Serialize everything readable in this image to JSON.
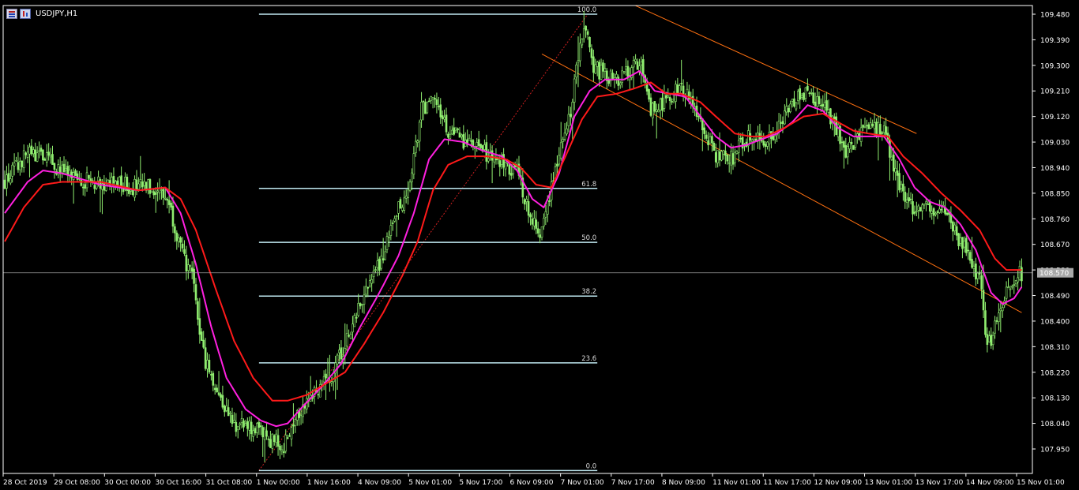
{
  "window": {
    "symbol_label": "USDJPY,H1"
  },
  "colors": {
    "background": "#000000",
    "axis": "#ffffff",
    "bull_candle": "#90ee70",
    "bear_candle": "#90ee70",
    "ma_fast": "#ff20e0",
    "ma_slow": "#ff1a1a",
    "fibo_level": "#c0e8f0",
    "fibo_trend": "#d02020",
    "channel": "#ff7010",
    "price_line": "#a0a0a0",
    "price_tag_bg": "#a8a8a8"
  },
  "chart_data": {
    "type": "candlestick",
    "symbol": "USDJPY",
    "timeframe": "H1",
    "y_ticks": [
      "109.480",
      "109.390",
      "109.300",
      "109.210",
      "109.120",
      "109.030",
      "108.940",
      "108.850",
      "108.760",
      "108.670",
      "108.580",
      "108.490",
      "108.400",
      "108.310",
      "108.220",
      "108.130",
      "108.040",
      "107.950"
    ],
    "ylim": [
      107.905,
      109.507
    ],
    "x_ticks": [
      "28 Oct 2019",
      "29 Oct 08:00",
      "30 Oct 00:00",
      "30 Oct 16:00",
      "31 Oct 08:00",
      "1 Nov 00:00",
      "1 Nov 16:00",
      "4 Nov 09:00",
      "5 Nov 01:00",
      "5 Nov 17:00",
      "6 Nov 09:00",
      "7 Nov 01:00",
      "7 Nov 17:00",
      "8 Nov 09:00",
      "11 Nov 01:00",
      "11 Nov 17:00",
      "12 Nov 09:00",
      "13 Nov 01:00",
      "13 Nov 17:00",
      "14 Nov 09:00",
      "15 Nov 01:00"
    ],
    "current_price": "108.570",
    "price_path": [
      [
        0,
        108.89
      ],
      [
        12,
        108.99
      ],
      [
        20,
        108.98
      ],
      [
        35,
        108.9
      ],
      [
        50,
        108.89
      ],
      [
        60,
        108.88
      ],
      [
        72,
        108.87
      ],
      [
        80,
        108.87
      ],
      [
        86,
        108.82
      ],
      [
        92,
        108.65
      ],
      [
        98,
        108.55
      ],
      [
        104,
        108.28
      ],
      [
        112,
        108.14
      ],
      [
        120,
        108.04
      ],
      [
        130,
        108.02
      ],
      [
        140,
        107.98
      ],
      [
        146,
        107.96
      ],
      [
        152,
        108.07
      ],
      [
        160,
        108.14
      ],
      [
        170,
        108.2
      ],
      [
        180,
        108.35
      ],
      [
        188,
        108.5
      ],
      [
        198,
        108.63
      ],
      [
        206,
        108.8
      ],
      [
        212,
        108.88
      ],
      [
        218,
        109.15
      ],
      [
        226,
        109.17
      ],
      [
        232,
        109.06
      ],
      [
        242,
        109.03
      ],
      [
        252,
        108.99
      ],
      [
        262,
        108.95
      ],
      [
        268,
        108.92
      ],
      [
        274,
        108.8
      ],
      [
        280,
        108.7
      ],
      [
        284,
        108.82
      ],
      [
        290,
        109.0
      ],
      [
        296,
        109.15
      ],
      [
        300,
        109.33
      ],
      [
        304,
        109.44
      ],
      [
        308,
        109.3
      ],
      [
        316,
        109.25
      ],
      [
        324,
        109.26
      ],
      [
        332,
        109.32
      ],
      [
        338,
        109.14
      ],
      [
        346,
        109.18
      ],
      [
        354,
        109.23
      ],
      [
        362,
        109.12
      ],
      [
        372,
        108.98
      ],
      [
        380,
        108.97
      ],
      [
        390,
        109.06
      ],
      [
        398,
        109.03
      ],
      [
        404,
        109.06
      ],
      [
        412,
        109.17
      ],
      [
        420,
        109.2
      ],
      [
        428,
        109.15
      ],
      [
        434,
        109.1
      ],
      [
        440,
        109.0
      ],
      [
        448,
        109.06
      ],
      [
        454,
        109.07
      ],
      [
        460,
        109.08
      ],
      [
        466,
        108.92
      ],
      [
        474,
        108.8
      ],
      [
        482,
        108.8
      ],
      [
        490,
        108.79
      ],
      [
        498,
        108.7
      ],
      [
        504,
        108.63
      ],
      [
        510,
        108.55
      ],
      [
        514,
        108.3
      ],
      [
        518,
        108.38
      ],
      [
        524,
        108.5
      ],
      [
        530,
        108.58
      ],
      [
        532,
        108.57
      ]
    ],
    "series": [
      {
        "name": "",
        "color": "#ff20e0",
        "values": [
          [
            0,
            108.78
          ],
          [
            12,
            108.89
          ],
          [
            20,
            108.93
          ],
          [
            30,
            108.92
          ],
          [
            50,
            108.88
          ],
          [
            70,
            108.86
          ],
          [
            84,
            108.87
          ],
          [
            92,
            108.78
          ],
          [
            100,
            108.6
          ],
          [
            108,
            108.38
          ],
          [
            116,
            108.2
          ],
          [
            126,
            108.09
          ],
          [
            134,
            108.05
          ],
          [
            142,
            108.03
          ],
          [
            148,
            108.04
          ],
          [
            156,
            108.1
          ],
          [
            166,
            108.17
          ],
          [
            176,
            108.25
          ],
          [
            186,
            108.38
          ],
          [
            196,
            108.5
          ],
          [
            206,
            108.63
          ],
          [
            214,
            108.78
          ],
          [
            222,
            108.97
          ],
          [
            230,
            109.04
          ],
          [
            240,
            109.03
          ],
          [
            250,
            109.0
          ],
          [
            260,
            108.98
          ],
          [
            268,
            108.93
          ],
          [
            276,
            108.83
          ],
          [
            282,
            108.8
          ],
          [
            290,
            108.92
          ],
          [
            298,
            109.12
          ],
          [
            306,
            109.21
          ],
          [
            314,
            109.25
          ],
          [
            324,
            109.25
          ],
          [
            332,
            109.28
          ],
          [
            340,
            109.21
          ],
          [
            348,
            109.2
          ],
          [
            356,
            109.19
          ],
          [
            364,
            109.12
          ],
          [
            372,
            109.05
          ],
          [
            380,
            109.01
          ],
          [
            388,
            109.02
          ],
          [
            396,
            109.04
          ],
          [
            404,
            109.06
          ],
          [
            412,
            109.1
          ],
          [
            420,
            109.16
          ],
          [
            428,
            109.14
          ],
          [
            436,
            109.08
          ],
          [
            444,
            109.05
          ],
          [
            452,
            109.05
          ],
          [
            460,
            109.05
          ],
          [
            468,
            108.97
          ],
          [
            476,
            108.87
          ],
          [
            484,
            108.82
          ],
          [
            492,
            108.8
          ],
          [
            500,
            108.74
          ],
          [
            508,
            108.65
          ],
          [
            516,
            108.5
          ],
          [
            522,
            108.46
          ],
          [
            528,
            108.48
          ],
          [
            532,
            108.52
          ]
        ]
      },
      {
        "name": "",
        "color": "#ff1a1a",
        "values": [
          [
            0,
            108.68
          ],
          [
            10,
            108.8
          ],
          [
            20,
            108.88
          ],
          [
            30,
            108.89
          ],
          [
            50,
            108.89
          ],
          [
            70,
            108.86
          ],
          [
            84,
            108.87
          ],
          [
            92,
            108.83
          ],
          [
            100,
            108.72
          ],
          [
            110,
            108.52
          ],
          [
            120,
            108.33
          ],
          [
            130,
            108.2
          ],
          [
            140,
            108.12
          ],
          [
            148,
            108.12
          ],
          [
            158,
            108.14
          ],
          [
            168,
            108.18
          ],
          [
            178,
            108.22
          ],
          [
            188,
            108.32
          ],
          [
            198,
            108.43
          ],
          [
            208,
            108.56
          ],
          [
            216,
            108.68
          ],
          [
            224,
            108.86
          ],
          [
            232,
            108.95
          ],
          [
            242,
            108.98
          ],
          [
            252,
            108.98
          ],
          [
            262,
            108.97
          ],
          [
            270,
            108.94
          ],
          [
            278,
            108.88
          ],
          [
            286,
            108.87
          ],
          [
            294,
            108.99
          ],
          [
            302,
            109.11
          ],
          [
            310,
            109.19
          ],
          [
            320,
            109.2
          ],
          [
            330,
            109.22
          ],
          [
            338,
            109.24
          ],
          [
            346,
            109.2
          ],
          [
            354,
            109.2
          ],
          [
            364,
            109.17
          ],
          [
            372,
            109.12
          ],
          [
            382,
            109.06
          ],
          [
            390,
            109.05
          ],
          [
            398,
            109.05
          ],
          [
            408,
            109.08
          ],
          [
            418,
            109.12
          ],
          [
            428,
            109.13
          ],
          [
            436,
            109.1
          ],
          [
            444,
            109.07
          ],
          [
            452,
            109.06
          ],
          [
            462,
            109.05
          ],
          [
            470,
            108.98
          ],
          [
            480,
            108.92
          ],
          [
            490,
            108.85
          ],
          [
            500,
            108.79
          ],
          [
            510,
            108.72
          ],
          [
            518,
            108.62
          ],
          [
            524,
            108.58
          ],
          [
            532,
            108.58
          ]
        ]
      }
    ],
    "fibonacci": {
      "levels": [
        {
          "label": "100.0",
          "price": 109.48
        },
        {
          "label": "61.8",
          "price": 108.867
        },
        {
          "label": "50.0",
          "price": 108.677
        },
        {
          "label": "38.2",
          "price": 108.488
        },
        {
          "label": "23.6",
          "price": 108.253
        },
        {
          "label": "0.0",
          "price": 107.874
        }
      ],
      "trend_from": {
        "bar": 133,
        "price": 107.874
      },
      "trend_to": {
        "bar": 305,
        "price": 109.48
      },
      "level_start_bar": 133,
      "level_end_bar": 310
    },
    "channel": {
      "upper": {
        "from": [
          330,
          109.51
        ],
        "to": [
          477,
          109.06
        ]
      },
      "lower": {
        "from": [
          281,
          109.34
        ],
        "to": [
          532,
          108.43
        ]
      }
    }
  }
}
